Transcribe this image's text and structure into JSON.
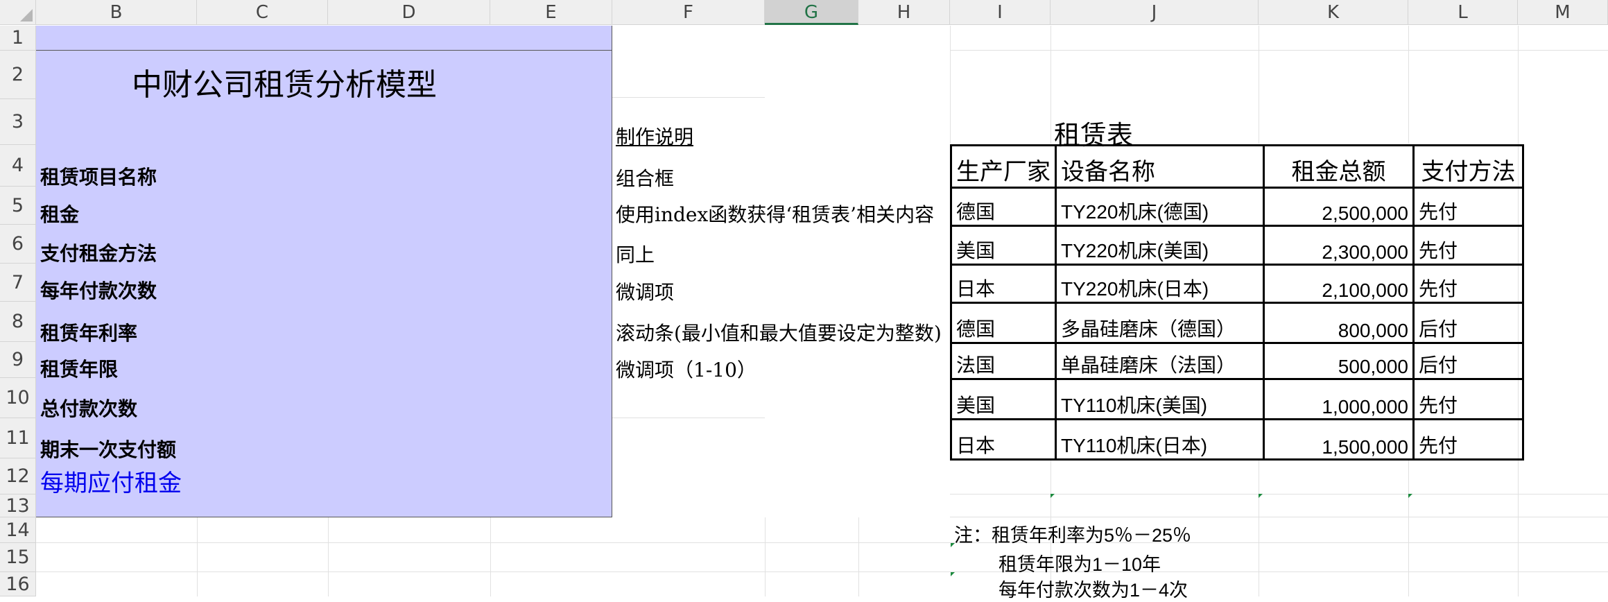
{
  "columns": [
    "B",
    "C",
    "D",
    "E",
    "F",
    "G",
    "H",
    "I",
    "J",
    "K",
    "L",
    "M"
  ],
  "selected_column": "G",
  "rows": [
    "1",
    "2",
    "3",
    "4",
    "5",
    "6",
    "7",
    "8",
    "9",
    "10",
    "11",
    "12",
    "13",
    "14",
    "15",
    "16"
  ],
  "model": {
    "title": "中财公司租赁分析模型",
    "labels": [
      "租赁项目名称",
      "租金",
      "支付租金方法",
      "每年付款次数",
      "租赁年利率",
      "租赁年限",
      "总付款次数",
      "期末一次支付额"
    ],
    "highlight_label": "每期应付租金"
  },
  "notes": {
    "heading": "制作说明",
    "items": [
      "组合框",
      "使用index函数获得‘租赁表’相关内容",
      "同上",
      "微调项",
      "滚动条(最小值和最大值要设定为整数)",
      "微调项（1-10）"
    ]
  },
  "lease_table": {
    "title": "租赁表",
    "headers": [
      "生产厂家",
      "设备名称",
      "租金总额",
      "支付方法"
    ],
    "rows": [
      [
        "德国",
        "TY220机床(德国)",
        "2,500,000",
        "先付"
      ],
      [
        "美国",
        "TY220机床(美国)",
        "2,300,000",
        "先付"
      ],
      [
        "日本",
        "TY220机床(日本)",
        "2,100,000",
        "先付"
      ],
      [
        "德国",
        "多晶硅磨床（德国）",
        "800,000",
        "后付"
      ],
      [
        "法国",
        "单晶硅磨床（法国）",
        "500,000",
        "后付"
      ],
      [
        "美国",
        "TY110机床(美国)",
        "1,000,000",
        "先付"
      ],
      [
        "日本",
        "TY110机床(日本)",
        "1,500,000",
        "先付"
      ]
    ]
  },
  "footnotes": [
    "注：租赁年利率为5％－25％",
    "租赁年限为1－10年",
    "每年付款次数为1－4次"
  ],
  "colors": {
    "panel": "#ccccff",
    "accent": "#217346",
    "link_blue": "#0000ee"
  }
}
